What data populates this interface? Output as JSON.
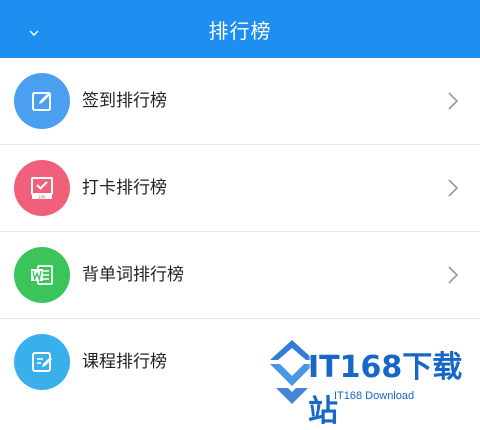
{
  "header": {
    "title": "排行榜",
    "bg": "#1f8ef1"
  },
  "items": [
    {
      "label": "签到排行榜",
      "icon": "edit-icon",
      "color": "#4a9ff0"
    },
    {
      "label": "打卡排行榜",
      "icon": "calendar-check-icon",
      "color": "#f1607a"
    },
    {
      "label": "背单词排行榜",
      "icon": "word-doc-icon",
      "color": "#3bc45a"
    },
    {
      "label": "课程排行榜",
      "icon": "notes-edit-icon",
      "color": "#39b0ec"
    }
  ],
  "watermark": {
    "text": "IT168下载站",
    "sub": "IT168 Download",
    "color": "#1667c8"
  }
}
